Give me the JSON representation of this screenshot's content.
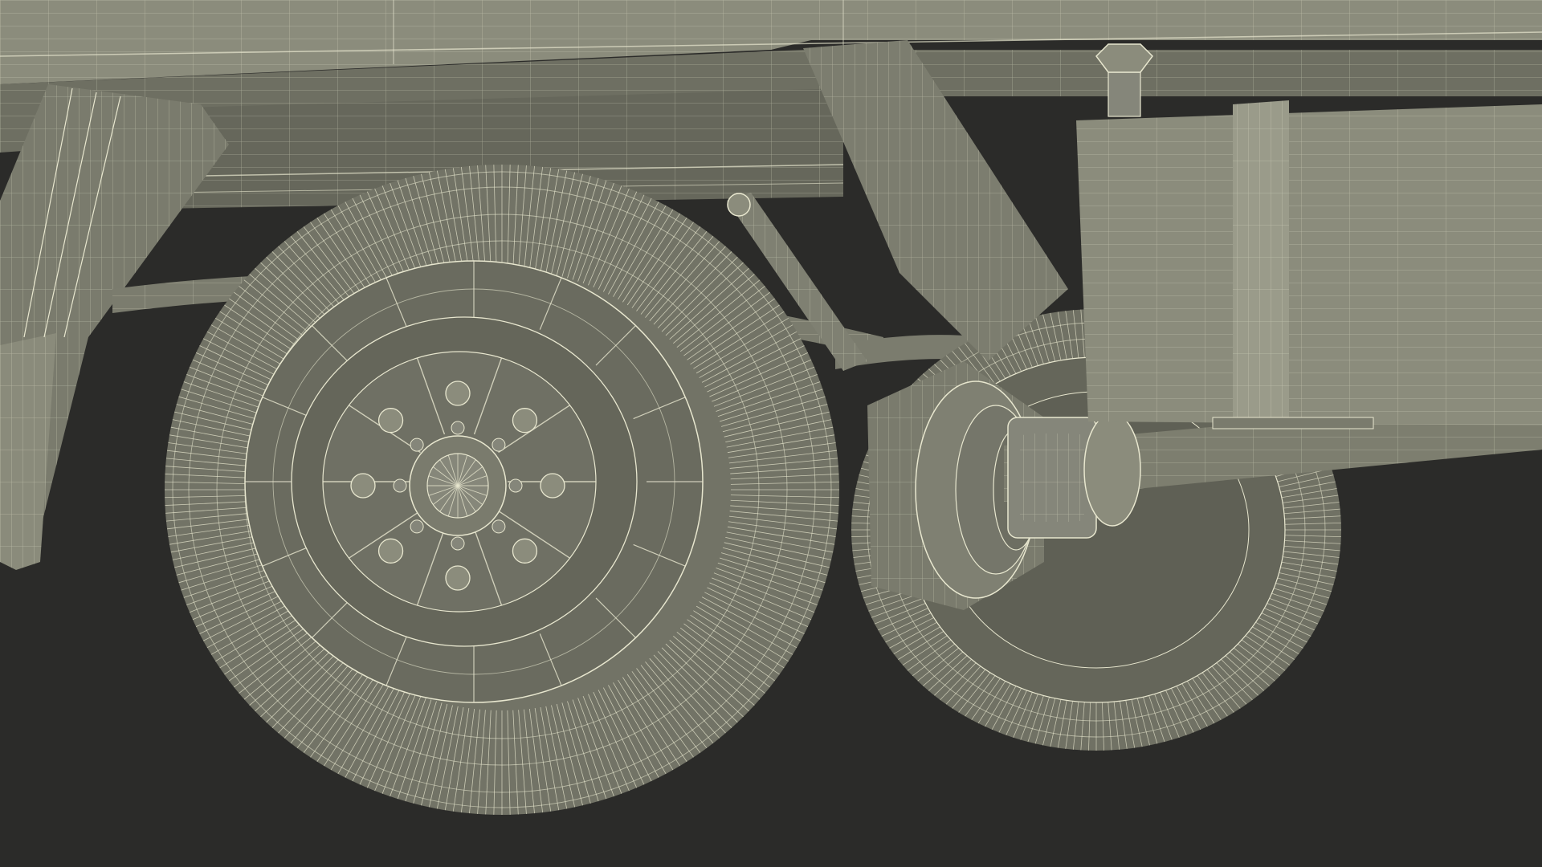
{
  "scene": {
    "subject": "truck-rear-axle-wireframe",
    "colors": {
      "background": "#2b2b29",
      "surface": "#7d7e6f",
      "surface_light": "#8b8c7c",
      "surface_dark": "#5f6055",
      "tire": "#707164",
      "wire": "#e8e7cf",
      "wire_dim": "#c9c8b0"
    }
  }
}
